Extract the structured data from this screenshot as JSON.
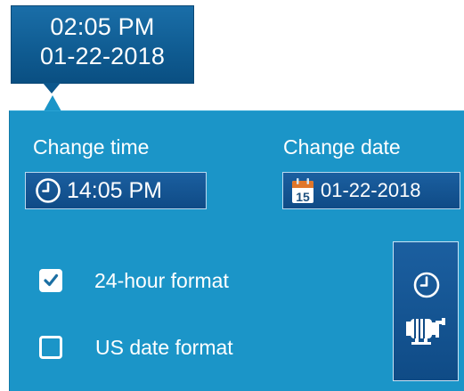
{
  "header": {
    "time": "02:05 PM",
    "date": "01-22-2018"
  },
  "time_section": {
    "label": "Change time",
    "value": "14:05 PM",
    "icon": "clock-icon"
  },
  "date_section": {
    "label": "Change date",
    "value": "01-22-2018",
    "icon_day": "15",
    "icon": "calendar-icon"
  },
  "options": {
    "format24_label": "24-hour format",
    "format24_checked": true,
    "us_date_label": "US date format",
    "us_date_checked": false
  },
  "mode_button": {
    "icons": [
      "clock-icon",
      "pump-motor-icon"
    ]
  },
  "colors": {
    "panel": "#1b95c8",
    "field": "#0f4b86",
    "badge": "#0f5b91",
    "text": "#ffffff"
  }
}
